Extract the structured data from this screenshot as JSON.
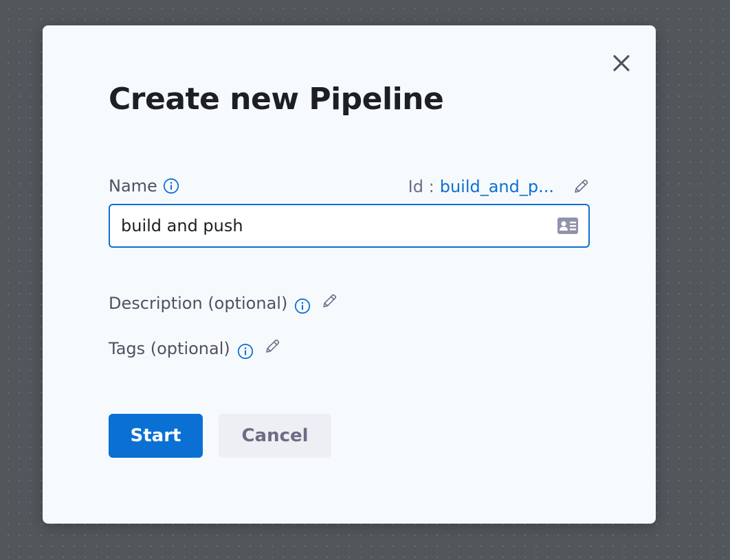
{
  "dialog": {
    "title": "Create new Pipeline",
    "close_icon": "close-icon"
  },
  "name_field": {
    "label": "Name",
    "value": "build and push",
    "id_prefix": "Id :",
    "id_value": "build_and_p...",
    "info_icon": "info-icon",
    "edit_icon": "pencil-icon",
    "trailing_icon": "id-card-icon"
  },
  "description": {
    "label": "Description (optional)",
    "info_icon": "info-icon",
    "edit_icon": "pencil-icon"
  },
  "tags": {
    "label": "Tags (optional)",
    "info_icon": "info-icon",
    "edit_icon": "pencil-icon"
  },
  "actions": {
    "start_label": "Start",
    "cancel_label": "Cancel"
  },
  "colors": {
    "accent": "#0b70d3",
    "dialog_bg": "#f7fafd",
    "backdrop": "#52575c",
    "title": "#1c1f24",
    "label": "#4f5162",
    "secondary_button_bg": "#eeeff4"
  }
}
